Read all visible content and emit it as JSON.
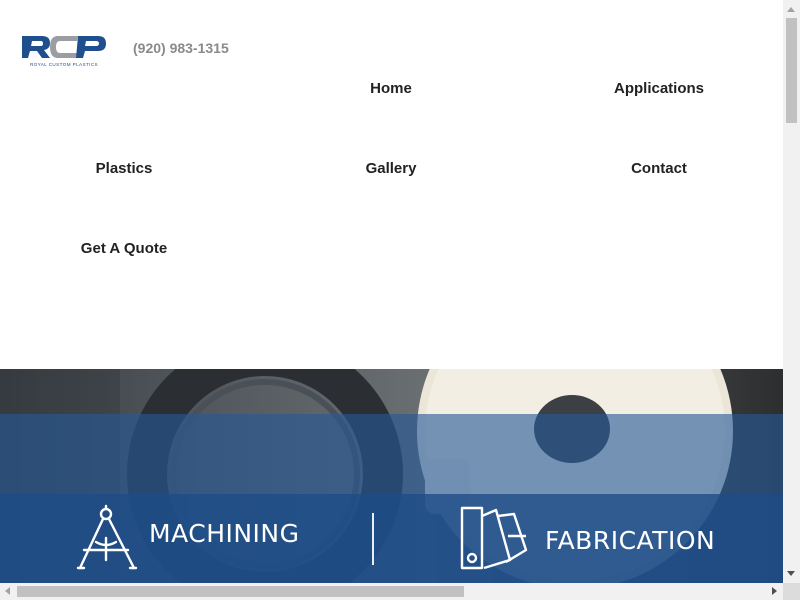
{
  "header": {
    "logo": {
      "text": "RCP",
      "subtitle": "ROYAL CUSTOM PLASTICS",
      "icon": "rcp-logo"
    },
    "phone": "(920) 983-1315"
  },
  "nav": {
    "items": [
      {
        "label": "Home"
      },
      {
        "label": "Applications"
      },
      {
        "label": "Plastics"
      },
      {
        "label": "Gallery"
      },
      {
        "label": "Contact"
      },
      {
        "label": "Get A Quote"
      }
    ]
  },
  "hero": {
    "services": [
      {
        "label": "MACHINING",
        "icon": "drafting-compass-icon"
      },
      {
        "label": "FABRICATION",
        "icon": "color-swatch-icon"
      }
    ]
  },
  "colors": {
    "brand_blue": "#1e4e8a",
    "band_blue": "#255998",
    "phone_gray": "#8a8a8a",
    "nav_text": "#222222"
  }
}
